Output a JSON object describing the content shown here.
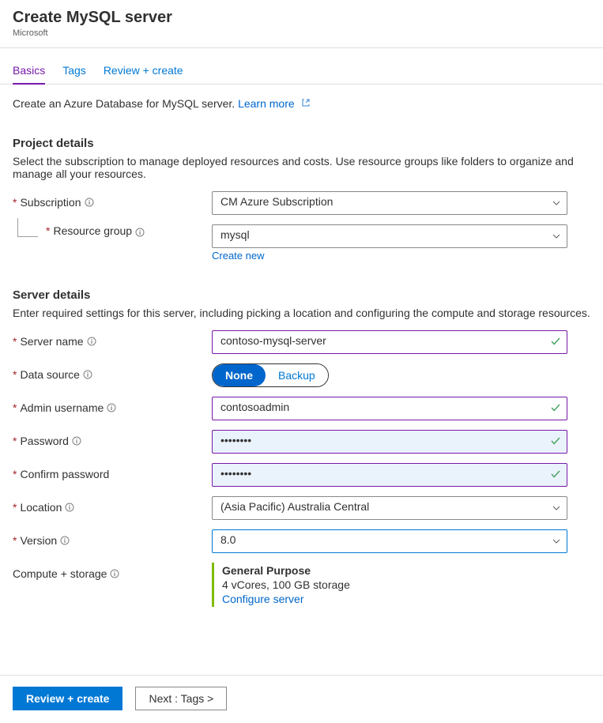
{
  "header": {
    "title": "Create MySQL server",
    "subtitle": "Microsoft"
  },
  "tabs": {
    "items": [
      {
        "label": "Basics",
        "active": true
      },
      {
        "label": "Tags",
        "active": false
      },
      {
        "label": "Review + create",
        "active": false
      }
    ]
  },
  "intro": {
    "text": "Create an Azure Database for MySQL server. ",
    "learn_more": "Learn more"
  },
  "sections": {
    "project": {
      "heading": "Project details",
      "desc": "Select the subscription to manage deployed resources and costs. Use resource groups like folders to organize and manage all your resources.",
      "subscription_label": "Subscription",
      "subscription_value": "CM Azure Subscription",
      "rg_label": "Resource group",
      "rg_value": "mysql",
      "create_new": "Create new"
    },
    "server": {
      "heading": "Server details",
      "desc": "Enter required settings for this server, including picking a location and configuring the compute and storage resources.",
      "server_name_label": "Server name",
      "server_name_value": "contoso-mysql-server",
      "data_source_label": "Data source",
      "data_source_options": {
        "none": "None",
        "backup": "Backup"
      },
      "admin_label": "Admin username",
      "admin_value": "contosoadmin",
      "password_label": "Password",
      "password_value": "••••••••",
      "confirm_label": "Confirm password",
      "confirm_value": "••••••••",
      "location_label": "Location",
      "location_value": "(Asia Pacific) Australia Central",
      "version_label": "Version",
      "version_value": "8.0",
      "compute_label": "Compute + storage",
      "compute_tier": "General Purpose",
      "compute_details": "4 vCores, 100 GB storage",
      "configure_link": "Configure server"
    }
  },
  "footer": {
    "review": "Review + create",
    "next": "Next : Tags >"
  }
}
